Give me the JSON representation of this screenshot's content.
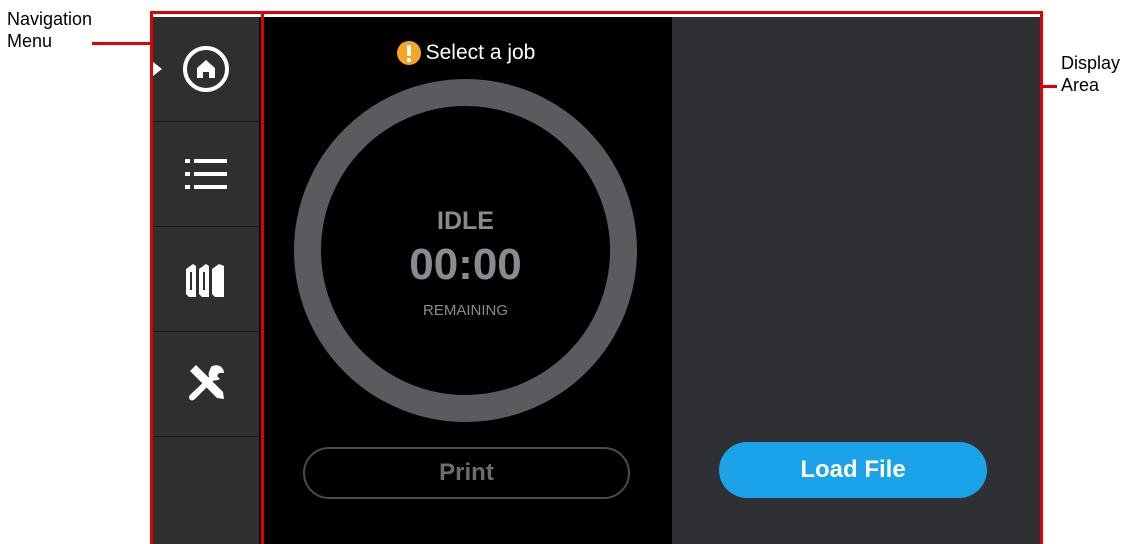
{
  "callouts": {
    "navigation_menu": "Navigation\nMenu",
    "display_area": "Display\nArea"
  },
  "nav": {
    "items": [
      {
        "icon": "home-icon",
        "selected": true
      },
      {
        "icon": "list-icon",
        "selected": false
      },
      {
        "icon": "materials-icon",
        "selected": false
      },
      {
        "icon": "tools-icon",
        "selected": false
      }
    ]
  },
  "status": {
    "icon": "warning-icon",
    "text": "Select a job"
  },
  "job": {
    "state": "IDLE",
    "time": "00:00",
    "time_label": "REMAINING"
  },
  "buttons": {
    "print": "Print",
    "load_file": "Load File"
  },
  "colors": {
    "annotation": "#e00000",
    "accent": "#1aa3e8",
    "warning": "#f5a623",
    "ring": "#5a5b5f"
  }
}
